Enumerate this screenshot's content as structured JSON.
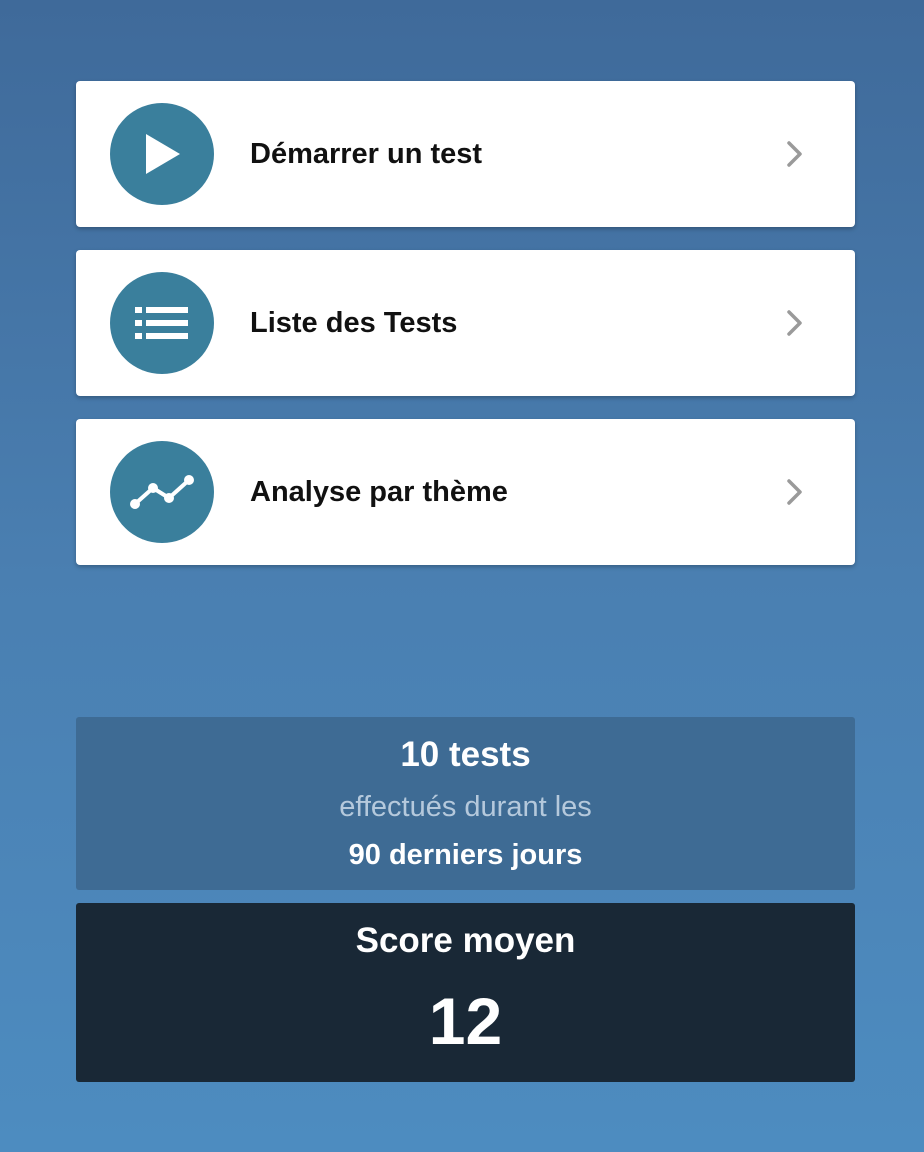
{
  "menu": {
    "items": [
      {
        "label": "Démarrer un test",
        "icon": "play-icon"
      },
      {
        "label": "Liste des Tests",
        "icon": "list-icon"
      },
      {
        "label": "Analyse par thème",
        "icon": "trend-line-icon"
      }
    ],
    "chevron_icon": "chevron-right-icon"
  },
  "stats": {
    "count": "10 tests",
    "subtitle": "effectués durant les",
    "period": "90 derniers jours"
  },
  "score": {
    "label": "Score moyen",
    "value": "12"
  },
  "colors": {
    "background_top": "#3f6a9a",
    "background_bottom": "#4d8cc0",
    "icon_circle": "#3a7f9c",
    "stats_panel": "#3e6b94",
    "score_panel": "#192836",
    "card": "#ffffff"
  }
}
